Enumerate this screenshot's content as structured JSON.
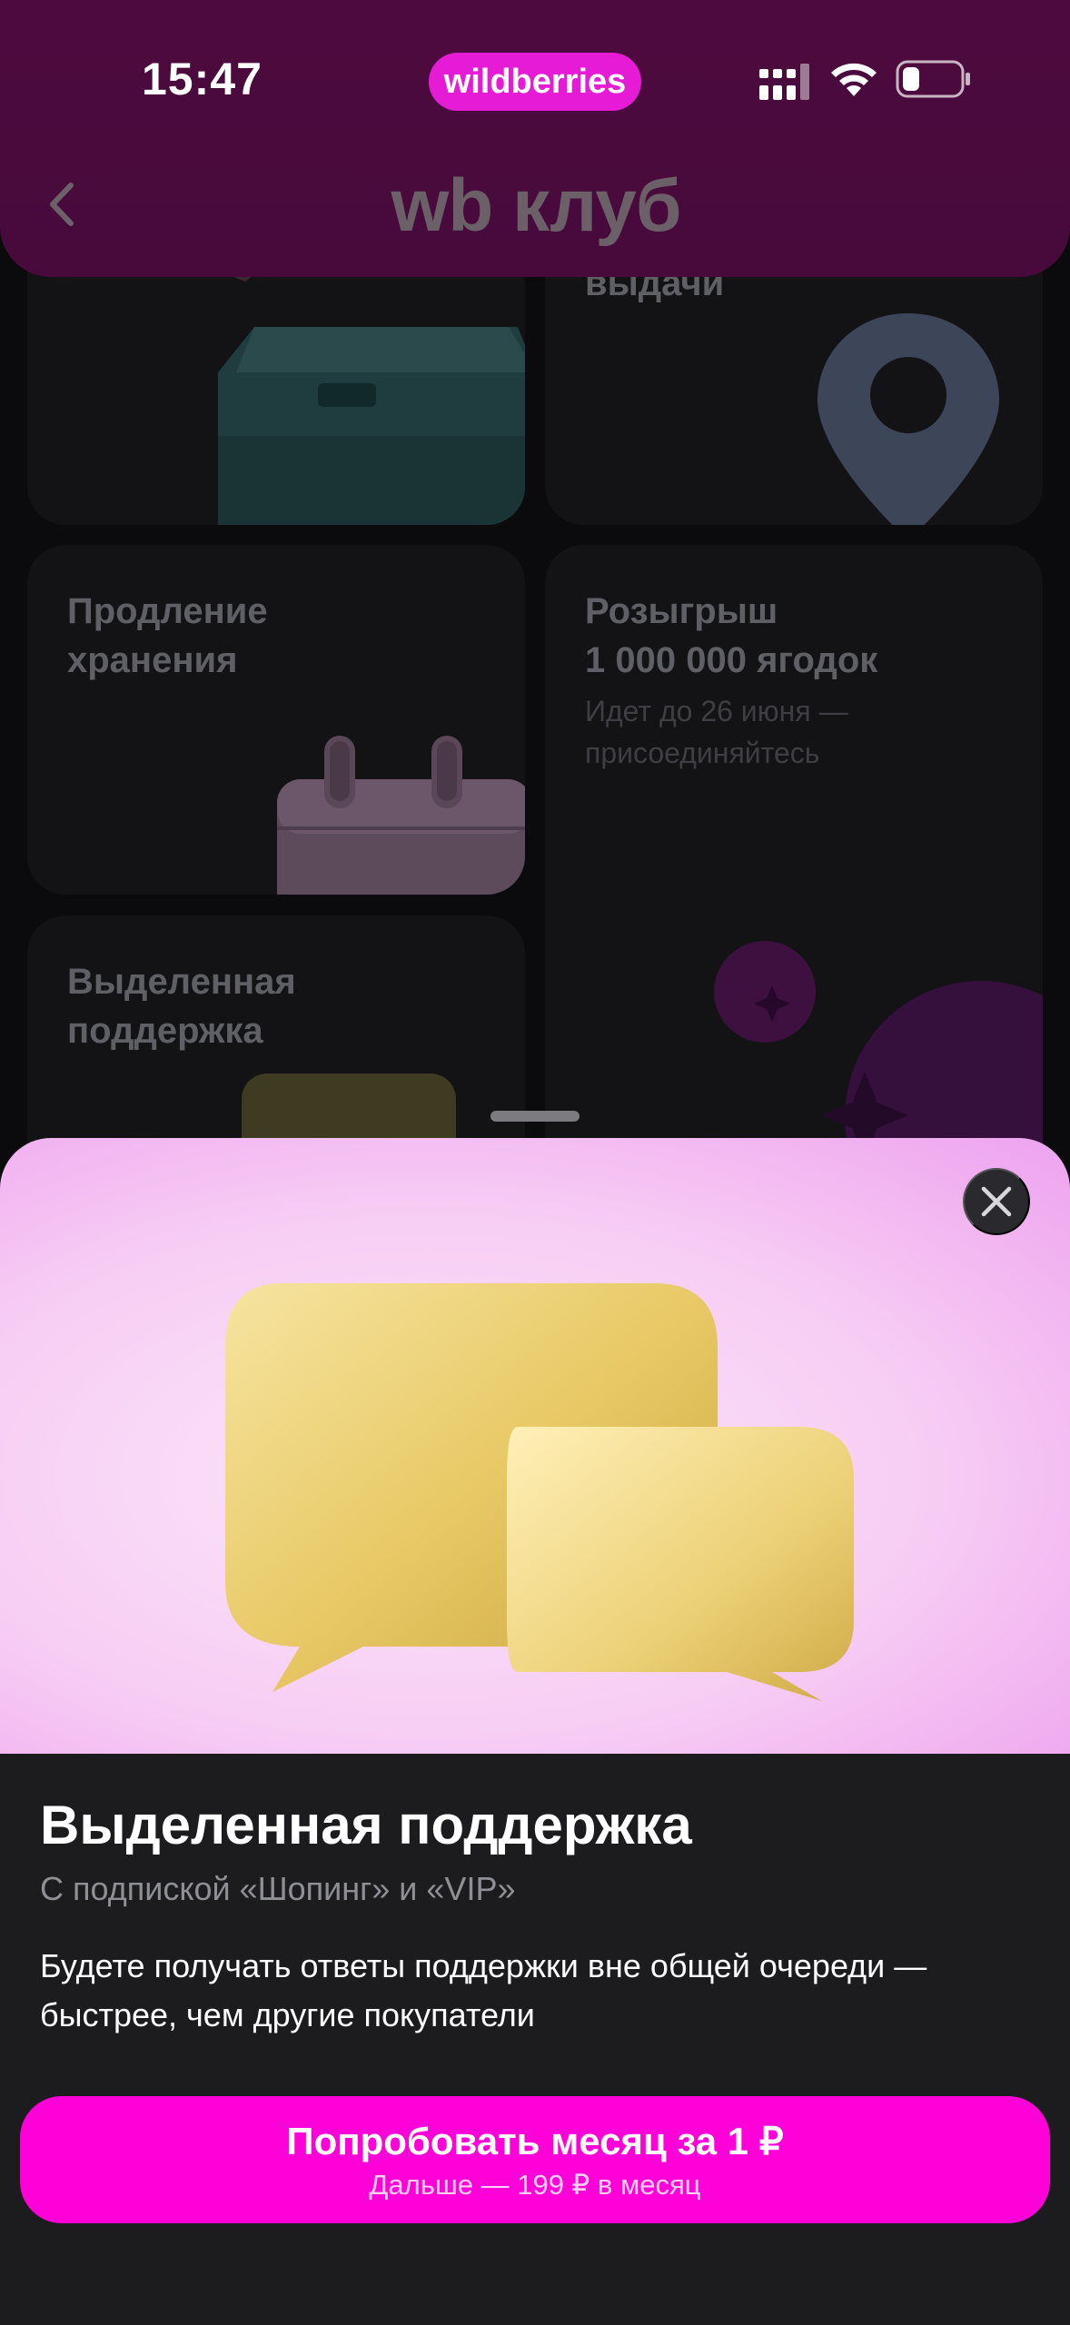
{
  "status_bar": {
    "time": "15:47",
    "brand": "wildberries"
  },
  "header": {
    "logo": "wb клуб"
  },
  "cards": [
    {
      "title": "",
      "subtitle": ""
    },
    {
      "title": "выдачи",
      "subtitle": ""
    },
    {
      "title": "Продление\nхранения",
      "subtitle": ""
    },
    {
      "title": "Розыгрыш\n1 000 000 ягодок",
      "subtitle": "Идет до 26 июня —\nприсоединяйтесь"
    },
    {
      "title": "Выделенная\nподдержка",
      "subtitle": ""
    }
  ],
  "sheet": {
    "title": "Выделенная поддержка",
    "subtitle": "С подпиской «Шопинг» и «VIP»",
    "description": "Будете получать ответы поддержки вне общей очереди — быстрее, чем другие покупатели",
    "cta_main": "Попробовать месяц за 1 ₽",
    "cta_sub": "Дальше — 199 ₽ в месяц"
  },
  "colors": {
    "accent": "#ff00d8",
    "header": "#4d0a3e",
    "sheet_bg": "#1c1c1e"
  },
  "icons": [
    "back-chevron-icon",
    "close-icon",
    "signal-icon",
    "wifi-icon",
    "battery-icon",
    "speech-bubbles-icon",
    "location-pin-icon",
    "calendar-icon",
    "berry-icon",
    "box-icon"
  ]
}
